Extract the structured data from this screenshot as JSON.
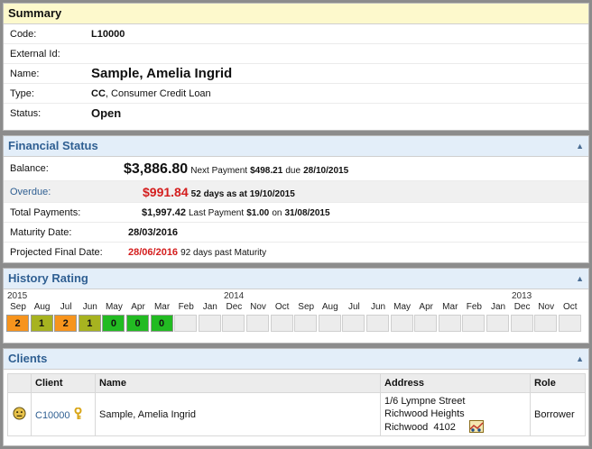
{
  "summary": {
    "title": "Summary",
    "rows": [
      {
        "label": "Code:",
        "value": "L10000"
      },
      {
        "label": "External Id:",
        "value": ""
      },
      {
        "label": "Name:",
        "value": "Sample, Amelia Ingrid"
      },
      {
        "label": "Type:",
        "code": "CC",
        "desc": ", Consumer Credit Loan"
      },
      {
        "label": "Status:",
        "value": "Open"
      }
    ]
  },
  "financial": {
    "title": "Financial Status",
    "balance": {
      "label": "Balance:",
      "value": "$3,886.80",
      "next_text": "Next Payment",
      "next_amount": "$498.21",
      "due_text": "due",
      "due_date": "28/10/2015"
    },
    "overdue": {
      "label": "Overdue:",
      "value": "$991.84",
      "info": "52 days as at 19/10/2015"
    },
    "total": {
      "label": "Total Payments:",
      "value": "$1,997.42",
      "last_text": "Last Payment",
      "last_amount": "$1.00",
      "on_text": "on",
      "last_date": "31/08/2015"
    },
    "maturity": {
      "label": "Maturity Date:",
      "value": "28/03/2016"
    },
    "projected": {
      "label": "Projected Final Date:",
      "value": "28/06/2016",
      "info": "92 days past Maturity"
    }
  },
  "history": {
    "title": "History Rating",
    "years": [
      "2015",
      "2014",
      "2013"
    ],
    "months": [
      "Sep",
      "Aug",
      "Jul",
      "Jun",
      "May",
      "Apr",
      "Mar",
      "Feb",
      "Jan",
      "Dec",
      "Nov",
      "Oct",
      "Sep",
      "Aug",
      "Jul",
      "Jun",
      "May",
      "Apr",
      "Mar",
      "Feb",
      "Jan",
      "Dec",
      "Nov",
      "Oct"
    ],
    "ratings": [
      "2",
      "1",
      "2",
      "1",
      "0",
      "0",
      "0",
      "",
      "",
      "",
      "",
      "",
      "",
      "",
      "",
      "",
      "",
      "",
      "",
      "",
      "",
      "",
      "",
      ""
    ],
    "colors": {
      "0": "#22bb22",
      "1": "#a7b320",
      "2": "#f7941d",
      "empty": "#ececec"
    }
  },
  "clients": {
    "title": "Clients",
    "headers": {
      "client": "Client",
      "name": "Name",
      "address": "Address",
      "role": "Role"
    },
    "row": {
      "client": "C10000",
      "name": "Sample, Amelia Ingrid",
      "address1": "1/6 Lympne Street",
      "address2": "Richwood Heights",
      "address3": "Richwood  4102",
      "role": "Borrower"
    }
  }
}
